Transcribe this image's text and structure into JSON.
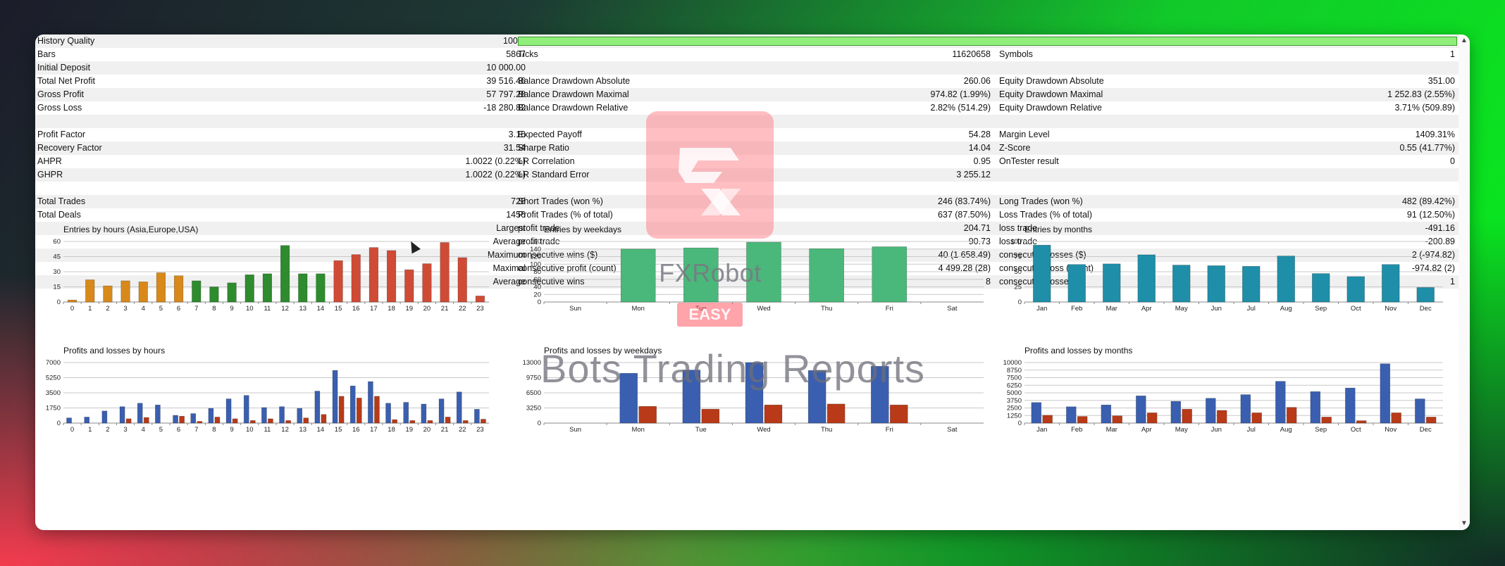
{
  "colors": {
    "accent_green": "#8fef7a",
    "bar_orange": "#d8891a",
    "bar_green": "#2e8b2e",
    "bar_red": "#cf4b35",
    "bar_blue": "#3a5fb0",
    "bar_brown": "#b83a18",
    "bar_teal": "#1f8ea8",
    "bar_mint": "#4ab87a"
  },
  "stats": {
    "rows": [
      {
        "l1": "History Quality",
        "v1": "100%",
        "l2": "",
        "v2": "",
        "l3": "",
        "v3": "",
        "shade": true,
        "bar": true
      },
      {
        "l1": "Bars",
        "v1": "5867",
        "l2": "Ticks",
        "v2": "11620658",
        "l3": "Symbols",
        "v3": "1",
        "shade": false
      },
      {
        "l1": "Initial Deposit",
        "v1": "10 000.00",
        "l2": "",
        "v2": "",
        "l3": "",
        "v3": "",
        "shade": true
      },
      {
        "l1": "Total Net Profit",
        "v1": "39 516.46",
        "l2": "Balance Drawdown Absolute",
        "v2": "260.06",
        "l3": "Equity Drawdown Absolute",
        "v3": "351.00",
        "shade": false
      },
      {
        "l1": "Gross Profit",
        "v1": "57 797.28",
        "l2": "Balance Drawdown Maximal",
        "v2": "974.82 (1.99%)",
        "l3": "Equity Drawdown Maximal",
        "v3": "1 252.83 (2.55%)",
        "shade": true
      },
      {
        "l1": "Gross Loss",
        "v1": "-18 280.82",
        "l2": "Balance Drawdown Relative",
        "v2": "2.82% (514.29)",
        "l3": "Equity Drawdown Relative",
        "v3": "3.71% (509.89)",
        "shade": false
      },
      {
        "l1": "",
        "v1": "",
        "l2": "",
        "v2": "",
        "l3": "",
        "v3": "",
        "shade": true
      },
      {
        "l1": "Profit Factor",
        "v1": "3.16",
        "l2": "Expected Payoff",
        "v2": "54.28",
        "l3": "Margin Level",
        "v3": "1409.31%",
        "shade": false
      },
      {
        "l1": "Recovery Factor",
        "v1": "31.54",
        "l2": "Sharpe Ratio",
        "v2": "14.04",
        "l3": "Z-Score",
        "v3": "0.55 (41.77%)",
        "shade": true
      },
      {
        "l1": "AHPR",
        "v1": "1.0022 (0.22%)",
        "l2": "LR Correlation",
        "v2": "0.95",
        "l3": "OnTester result",
        "v3": "0",
        "shade": false
      },
      {
        "l1": "GHPR",
        "v1": "1.0022 (0.22%)",
        "l2": "LR Standard Error",
        "v2": "3 255.12",
        "l3": "",
        "v3": "",
        "shade": true
      },
      {
        "l1": "",
        "v1": "",
        "l2": "",
        "v2": "",
        "l3": "",
        "v3": "",
        "shade": false
      },
      {
        "l1": "Total Trades",
        "v1": "728",
        "l2": "Short Trades (won %)",
        "v2": "246 (83.74%)",
        "l3": "Long Trades (won %)",
        "v3": "482 (89.42%)",
        "shade": true
      },
      {
        "l1": "Total Deals",
        "v1": "1456",
        "l2": "Profit Trades (% of total)",
        "v2": "637 (87.50%)",
        "l3": "Loss Trades (% of total)",
        "v3": "91 (12.50%)",
        "shade": false
      },
      {
        "l1": "",
        "v1": "Largest",
        "l2": "profit trade",
        "v2": "204.71",
        "l3": "loss trade",
        "v3": "-491.16",
        "shade": true
      },
      {
        "l1": "",
        "v1": "Average",
        "l2": "profit trade",
        "v2": "90.73",
        "l3": "loss trade",
        "v3": "-200.89",
        "shade": false
      },
      {
        "l1": "",
        "v1": "Maximum",
        "l2": "consecutive wins ($)",
        "v2": "40 (1 658.49)",
        "l3": "consecutive losses ($)",
        "v3": "2 (-974.82)",
        "shade": true
      },
      {
        "l1": "",
        "v1": "Maximal",
        "l2": "consecutive profit (count)",
        "v2": "4 499.28 (28)",
        "l3": "consecutive loss (count)",
        "v3": "-974.82 (2)",
        "shade": false
      },
      {
        "l1": "",
        "v1": "Average",
        "l2": "consecutive wins",
        "v2": "8",
        "l3": "consecutive losses",
        "v3": "1",
        "shade": true
      },
      {
        "l1": "",
        "v1": "",
        "l2": "",
        "v2": "",
        "l3": "",
        "v3": "",
        "shade": false
      }
    ]
  },
  "chart_data": [
    {
      "type": "bar",
      "title": "Entries by hours (Asia,Europe,USA)",
      "categories": [
        "0",
        "1",
        "2",
        "3",
        "4",
        "5",
        "6",
        "7",
        "8",
        "9",
        "10",
        "11",
        "12",
        "13",
        "14",
        "15",
        "16",
        "17",
        "18",
        "19",
        "20",
        "21",
        "22",
        "23"
      ],
      "values": [
        2,
        22,
        16,
        21,
        20,
        29,
        26,
        21,
        15,
        19,
        27,
        28,
        56,
        28,
        28,
        41,
        47,
        54,
        51,
        32,
        38,
        59,
        44,
        6
      ],
      "ylim": [
        0,
        60
      ],
      "yticks": [
        "0",
        "15",
        "30",
        "45",
        "60"
      ]
    },
    {
      "type": "bar",
      "title": "Entries by weekdays",
      "categories": [
        "Sun",
        "Mon",
        "Tue",
        "Wed",
        "Thu",
        "Fri",
        "Sat"
      ],
      "values": [
        0,
        140,
        143,
        158,
        141,
        146,
        0
      ],
      "ylim": [
        0,
        160
      ],
      "yticks": [
        "0",
        "20",
        "40",
        "60",
        "80",
        "100",
        "120",
        "140",
        "160"
      ]
    },
    {
      "type": "bar",
      "title": "Entries by months",
      "categories": [
        "Jan",
        "Feb",
        "Mar",
        "Apr",
        "May",
        "Jun",
        "Jul",
        "Aug",
        "Sep",
        "Oct",
        "Nov",
        "Dec"
      ],
      "values": [
        94,
        62,
        63,
        78,
        61,
        60,
        59,
        76,
        47,
        42,
        62,
        24
      ],
      "ylim": [
        0,
        100
      ],
      "yticks": [
        "0",
        "25",
        "50",
        "75",
        "100"
      ]
    },
    {
      "type": "bar",
      "title": "Profits and losses by hours",
      "categories": [
        "0",
        "1",
        "2",
        "3",
        "4",
        "5",
        "6",
        "7",
        "8",
        "9",
        "10",
        "11",
        "12",
        "13",
        "14",
        "15",
        "16",
        "17",
        "18",
        "19",
        "20",
        "21",
        "22",
        "23"
      ],
      "series": [
        {
          "values": [
            600,
            700,
            1400,
            1900,
            2300,
            2100,
            900,
            1100,
            1700,
            2800,
            3200,
            1800,
            1900,
            1700,
            3700,
            6100,
            4300,
            4800,
            2300,
            2400,
            2200,
            2800,
            3600,
            1600
          ]
        },
        {
          "values": [
            0,
            0,
            0,
            500,
            650,
            0,
            800,
            200,
            700,
            500,
            300,
            500,
            300,
            600,
            1000,
            3100,
            2900,
            3100,
            400,
            300,
            300,
            700,
            300,
            450
          ]
        }
      ],
      "ylim": [
        0,
        7000
      ],
      "yticks": [
        "0",
        "1750",
        "3500",
        "5250",
        "7000"
      ]
    },
    {
      "type": "bar",
      "title": "Profits and losses by weekdays",
      "categories": [
        "Sun",
        "Mon",
        "Tue",
        "Wed",
        "Thu",
        "Fri",
        "Sat"
      ],
      "series": [
        {
          "values": [
            0,
            10700,
            11400,
            13000,
            11300,
            12200,
            0
          ]
        },
        {
          "values": [
            0,
            3600,
            3000,
            3900,
            4100,
            3900,
            0
          ]
        }
      ],
      "ylim": [
        0,
        13000
      ],
      "yticks": [
        "0",
        "3250",
        "6500",
        "9750",
        "13000"
      ]
    },
    {
      "type": "bar",
      "title": "Profits and losses by months",
      "categories": [
        "Jan",
        "Feb",
        "Mar",
        "Apr",
        "May",
        "Jun",
        "Jul",
        "Aug",
        "Sep",
        "Oct",
        "Nov",
        "Dec"
      ],
      "series": [
        {
          "values": [
            3400,
            2700,
            3000,
            4500,
            3600,
            4100,
            4700,
            6900,
            5200,
            5800,
            9800,
            4000
          ]
        },
        {
          "values": [
            1300,
            1100,
            1200,
            1700,
            2300,
            2100,
            1700,
            2600,
            1000,
            400,
            1700,
            1000
          ]
        }
      ],
      "ylim": [
        0,
        10000
      ],
      "yticks": [
        "0",
        "1250",
        "2500",
        "3750",
        "5000",
        "6250",
        "7500",
        "8750",
        "10000"
      ]
    }
  ],
  "watermark": {
    "brand": "FXRobot",
    "easy": "EASY",
    "reports": "Bots Trading Reports"
  }
}
